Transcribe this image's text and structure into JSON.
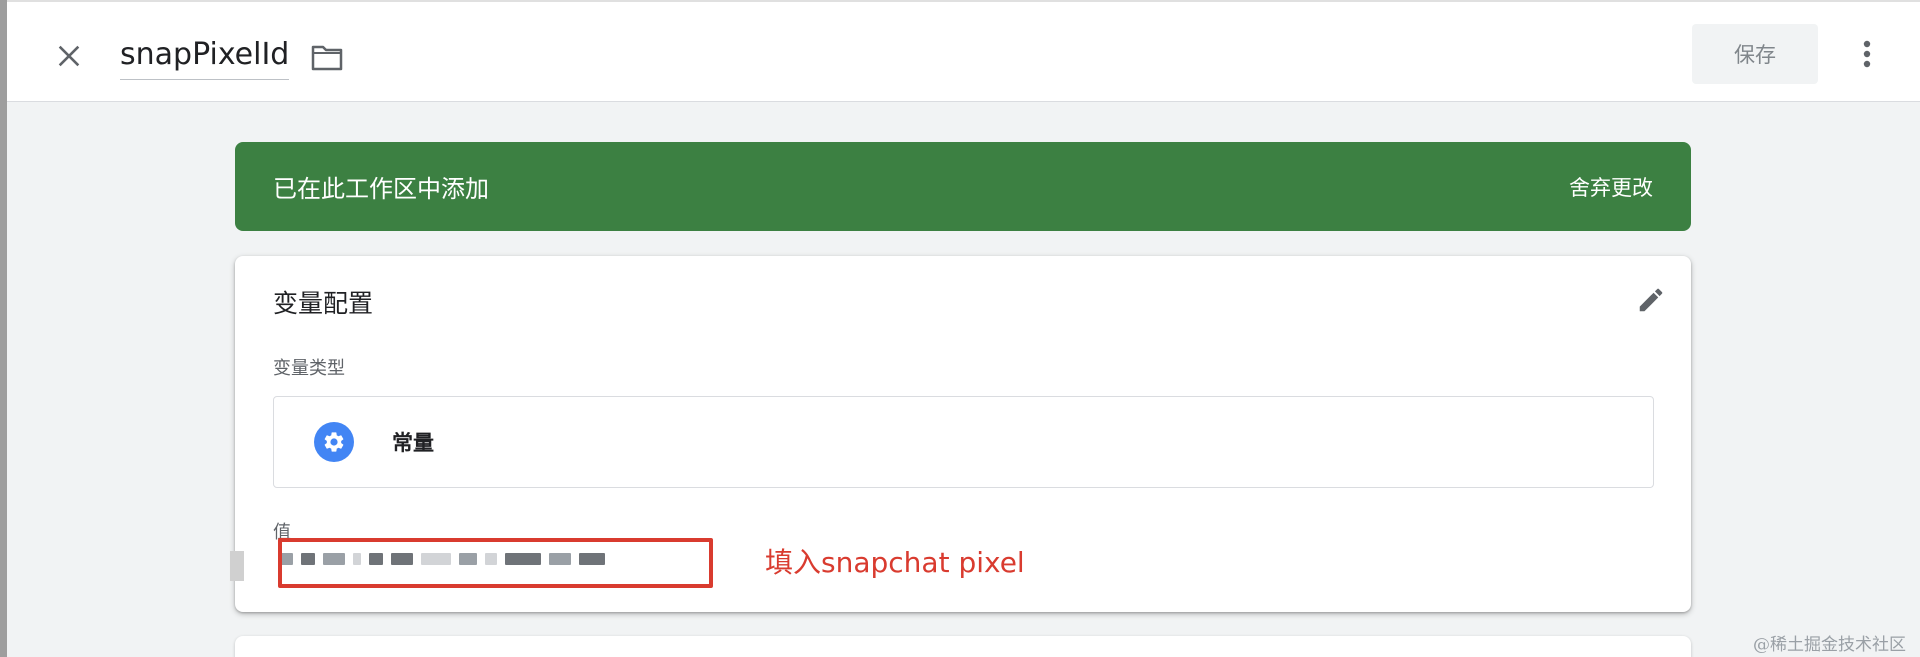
{
  "header": {
    "title": "snapPixelId",
    "save_label": "保存",
    "icons": {
      "close": "close-icon",
      "folder": "folder-icon",
      "more": "more-vert-icon"
    }
  },
  "banner": {
    "message": "已在此工作区中添加",
    "action": "舍弃更改",
    "color": "#3c8042"
  },
  "card": {
    "title": "变量配置",
    "type_label": "变量类型",
    "type": {
      "name": "常量",
      "icon": "gear-icon",
      "icon_color": "#4285f4"
    },
    "value_label": "值",
    "value": "",
    "value_redacted": true
  },
  "annotation": {
    "text": "填入snapchat pixel",
    "color": "#d93b2f"
  },
  "watermark": "@稀土掘金技术社区"
}
